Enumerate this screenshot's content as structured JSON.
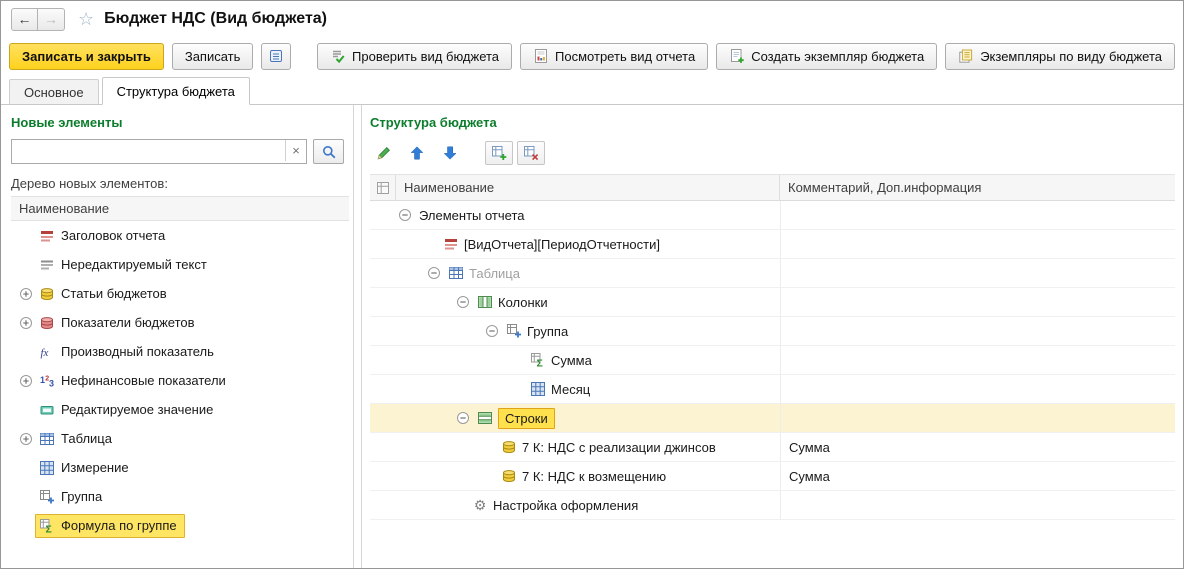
{
  "window": {
    "title": "Бюджет НДС (Вид бюджета)"
  },
  "icons": {
    "back": "←",
    "forward": "→",
    "star": "☆",
    "clear": "×",
    "gear": "⚙"
  },
  "toolbar": {
    "save_and_close": "Записать и закрыть",
    "save": "Записать",
    "check_budget_view": "Проверить вид бюджета",
    "view_report_form": "Посмотреть вид отчета",
    "create_budget_instance": "Создать экземпляр бюджета",
    "instances_by_budget_view": "Экземпляры по виду бюджета"
  },
  "tabs": [
    {
      "id": "main",
      "label": "Основное",
      "active": false
    },
    {
      "id": "budget-structure",
      "label": "Структура бюджета",
      "active": true
    }
  ],
  "left_panel": {
    "title": "Новые элементы",
    "search": {
      "value": "",
      "placeholder": ""
    },
    "tree_caption": "Дерево новых элементов:",
    "column_header": "Наименование",
    "items": [
      {
        "id": "report-title",
        "label": "Заголовок отчета",
        "icon": "report-header",
        "expandable": false,
        "selected": false
      },
      {
        "id": "static-text",
        "label": "Нередактируемый текст",
        "icon": "static-text",
        "expandable": false,
        "selected": false
      },
      {
        "id": "budget-articles",
        "label": "Статьи бюджетов",
        "icon": "budget-articles",
        "expandable": true,
        "selected": false
      },
      {
        "id": "budget-indicators",
        "label": "Показатели бюджетов",
        "icon": "budget-indicators",
        "expandable": true,
        "selected": false
      },
      {
        "id": "derived-indicator",
        "label": "Производный показатель",
        "icon": "fx",
        "expandable": false,
        "selected": false
      },
      {
        "id": "nonfinancial-indicators",
        "label": "Нефинансовые показатели",
        "icon": "numbers",
        "expandable": true,
        "selected": false
      },
      {
        "id": "editable-value",
        "label": "Редактируемое значение",
        "icon": "editable-value",
        "expandable": false,
        "selected": false
      },
      {
        "id": "table",
        "label": "Таблица",
        "icon": "table",
        "expandable": true,
        "selected": false
      },
      {
        "id": "dimension",
        "label": "Измерение",
        "icon": "dimension",
        "expandable": false,
        "selected": false
      },
      {
        "id": "group",
        "label": "Группа",
        "icon": "group",
        "expandable": false,
        "selected": false
      },
      {
        "id": "group-formula",
        "label": "Формула по группе",
        "icon": "sum-formula",
        "expandable": false,
        "selected": true
      }
    ]
  },
  "right_panel": {
    "title": "Структура бюджета",
    "columns": [
      "Наименование",
      "Комментарий, Доп.информация"
    ],
    "rows": [
      {
        "label": "Элементы отчета",
        "level": 0,
        "expander": true,
        "icon": "",
        "comment": "",
        "muted": false,
        "selected": false
      },
      {
        "label": "[ВидОтчета][ПериодОтчетности]",
        "level": 1,
        "expander": false,
        "icon": "report-header",
        "comment": "",
        "muted": false,
        "selected": false
      },
      {
        "label": "Таблица",
        "level": 1,
        "expander": true,
        "icon": "table",
        "comment": "",
        "muted": true,
        "selected": false
      },
      {
        "label": "Колонки",
        "level": 2,
        "expander": true,
        "icon": "columns",
        "comment": "",
        "muted": false,
        "selected": false
      },
      {
        "label": "Группа",
        "level": 3,
        "expander": true,
        "icon": "group",
        "comment": "",
        "muted": false,
        "selected": false
      },
      {
        "label": "Сумма",
        "level": 4,
        "expander": false,
        "icon": "sum-formula",
        "comment": "",
        "muted": false,
        "selected": false
      },
      {
        "label": "Месяц",
        "level": 4,
        "expander": false,
        "icon": "dimension",
        "comment": "",
        "muted": false,
        "selected": false
      },
      {
        "label": "Строки",
        "level": 2,
        "expander": true,
        "icon": "rows",
        "comment": "",
        "muted": false,
        "selected": true
      },
      {
        "label": "7 К: НДС с реализации джинсов",
        "level": 3,
        "expander": false,
        "icon": "budget-articles",
        "comment": "Сумма",
        "muted": false,
        "selected": false
      },
      {
        "label": "7 К: НДС к возмещению",
        "level": 3,
        "expander": false,
        "icon": "budget-articles",
        "comment": "Сумма",
        "muted": false,
        "selected": false
      },
      {
        "label": "Настройка оформления",
        "level": 2,
        "expander": false,
        "icon": "gear",
        "comment": "",
        "muted": false,
        "selected": false
      }
    ]
  },
  "structure_toolbar": {
    "actions": [
      "edit",
      "move-up",
      "move-down",
      "add-table-element",
      "delete-table-element"
    ]
  },
  "colors": {
    "primary_button": "#FFD21E",
    "selection": "#FFE564",
    "section_title": "#0C7D2C"
  }
}
